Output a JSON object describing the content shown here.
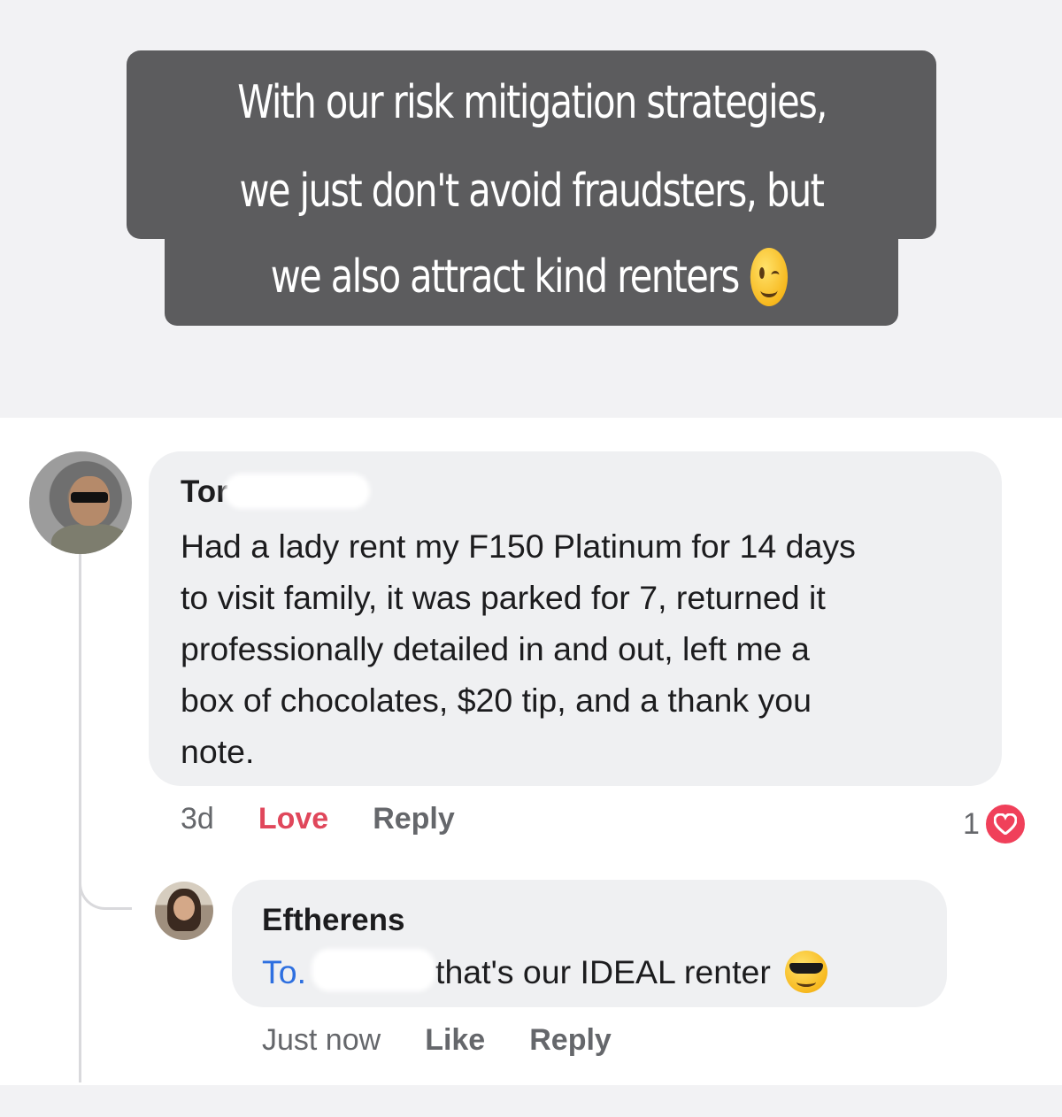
{
  "caption": {
    "lines": [
      "With our risk mitigation strategies,",
      "we just don't avoid fraudsters, but",
      "we also attract kind renters"
    ],
    "emoji": "winking-face"
  },
  "comment": {
    "author": "Tor",
    "text": "Had a lady rent my F150 Platinum for 14 days\nto visit family, it was parked for 7, returned it\nprofessionally detailed in and out, left me a\nbox of chocolates, $20 tip, and a thank you\nnote.",
    "time": "3d",
    "love_label": "Love",
    "reply_label": "Reply",
    "reaction_count": "1",
    "reaction_color": "#f0405a"
  },
  "reply": {
    "author": "Eftherens",
    "mention": "To.",
    "text": "that's our IDEAL renter",
    "emoji": "smiling-face-with-sunglasses",
    "time": "Just now",
    "like_label": "Like",
    "reply_label": "Reply"
  },
  "colors": {
    "caption_bg": "#5c5c5e",
    "bubble_bg": "#eff0f2",
    "love": "#e0475b",
    "mention": "#2d6fe0"
  }
}
